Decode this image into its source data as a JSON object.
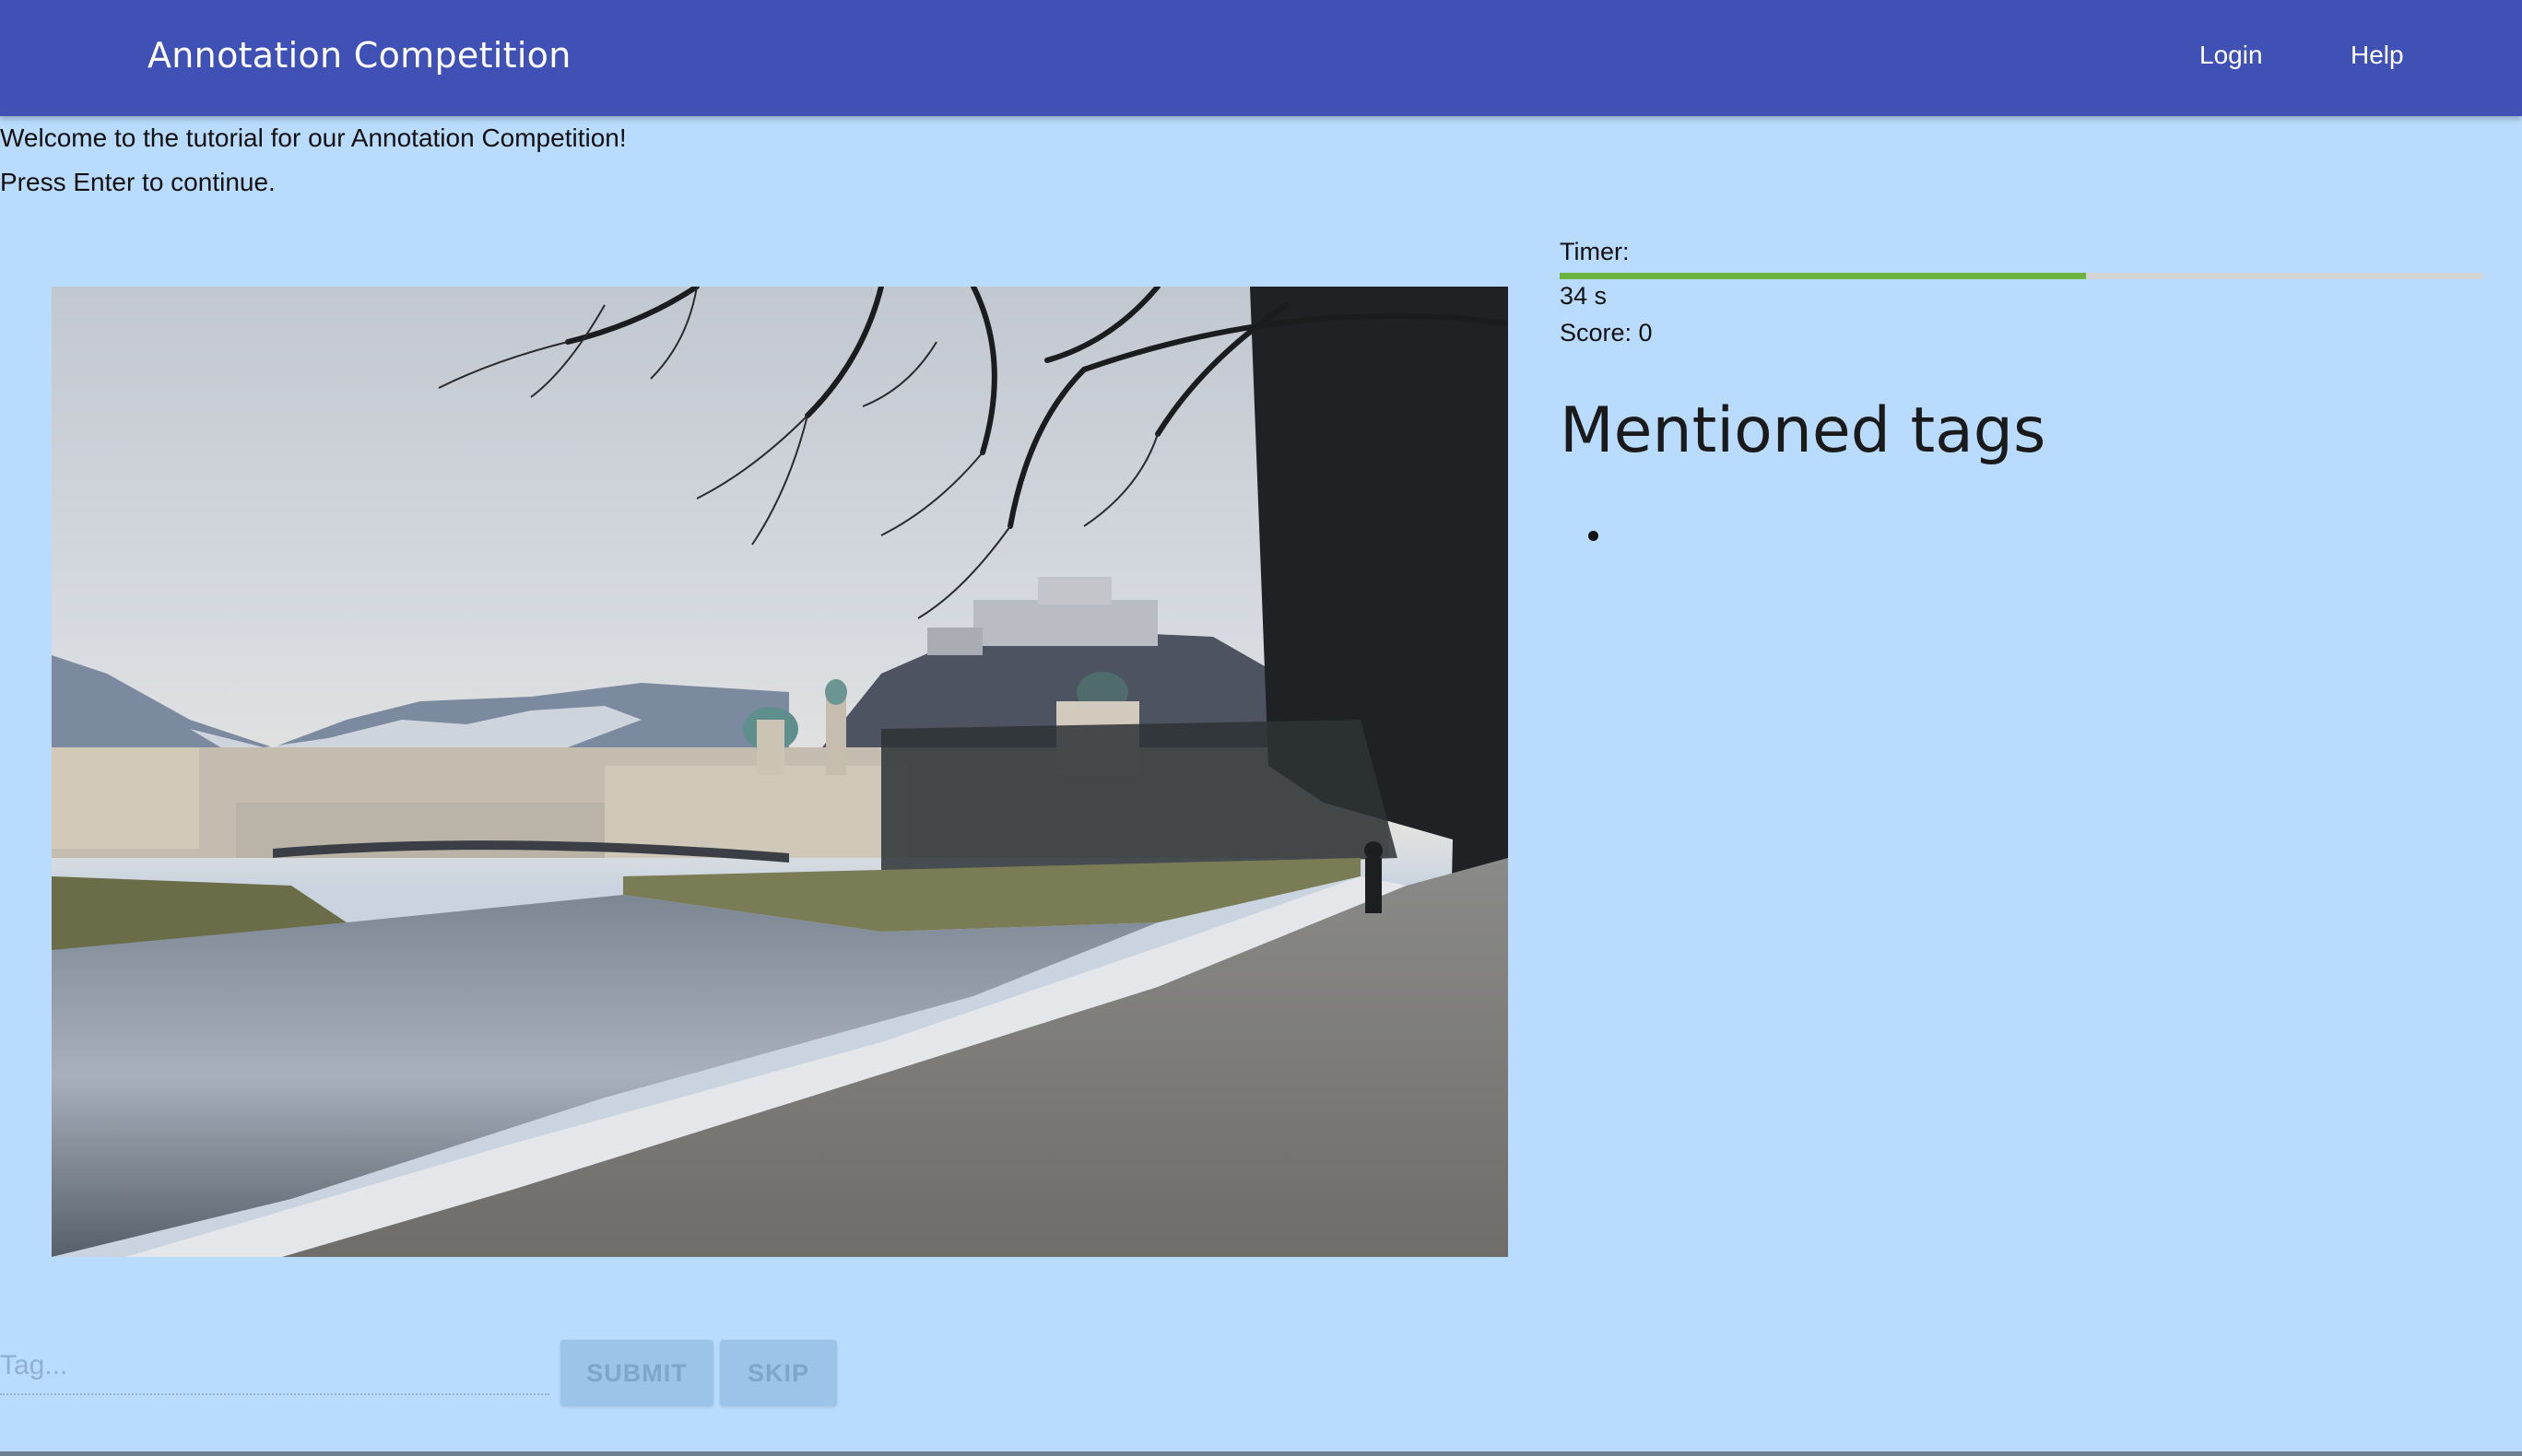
{
  "app": {
    "title": "Annotation Competition",
    "nav": {
      "login_label": "Login",
      "help_label": "Help"
    },
    "colors": {
      "appbar": "#3f51b5",
      "background": "#b9dbfd",
      "timer_fill": "#6db33f",
      "button_disabled": "#9cc3e8"
    }
  },
  "tutorial": {
    "welcome": "Welcome to the tutorial for our Annotation Competition!",
    "instruction": "Press Enter to continue."
  },
  "image": {
    "icon": "photo-riverside-city-with-hilltop-fortress"
  },
  "sidebar": {
    "timer_label": "Timer:",
    "timer_value": "34 s",
    "timer_progress": 0.57,
    "score": "Score: 0",
    "tags_heading": "Mentioned tags",
    "tags": [
      ""
    ]
  },
  "form": {
    "tag_placeholder": "Tag...",
    "submit_label": "SUBMIT",
    "skip_label": "SKIP"
  }
}
